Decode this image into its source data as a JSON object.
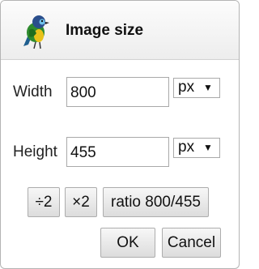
{
  "dialog": {
    "title": "Image size",
    "logo_icon": "green-bird-logo-icon"
  },
  "width_row": {
    "label": "Width",
    "value": "800",
    "unit": "px"
  },
  "height_row": {
    "label": "Height",
    "value": "455",
    "unit": "px"
  },
  "buttons": {
    "half": "÷2",
    "double": "×2",
    "ratio": "ratio 800/455",
    "ok": "OK",
    "cancel": "Cancel"
  },
  "colors": {
    "bird_green": "#2e8b2e",
    "bird_yellow": "#e8c21a",
    "bird_blue": "#2a4e8c",
    "header_bg": "#f2f2f2"
  }
}
